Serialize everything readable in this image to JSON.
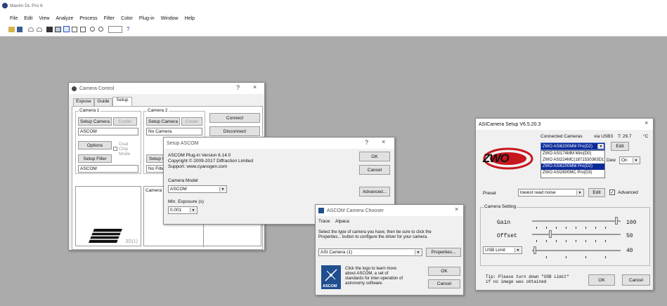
{
  "app": {
    "title": "MaxIm DL Pro 6"
  },
  "menu": [
    "File",
    "Edit",
    "View",
    "Analyze",
    "Process",
    "Filter",
    "Color",
    "Plug-in",
    "Window",
    "Help"
  ],
  "camera_control": {
    "title": "Camera Control",
    "tabs": [
      "Expose",
      "Guide",
      "Setup"
    ],
    "camera1_label": "Camera 1",
    "camera2_label": "Camera 2",
    "setup_camera": "Setup Camera",
    "cooler": "Cooler",
    "camera1_value": "ASCOM",
    "camera2_value": "No Camera",
    "options": "Options",
    "dual_chip_mode": "Dual Chip Mode",
    "setup_filter": "Setup Filter",
    "filter1_value": "ASCOM",
    "filter2_value": "No Filter",
    "connect": "Connect",
    "disconnect": "Disconnect",
    "camera1_status": "Camera 1 i",
    "badge": "3D(1)",
    "help": "?",
    "close": "×"
  },
  "setup_ascom": {
    "title": "Setup ASCOM",
    "line1": "ASCOM Plug-in Version 6.14.0",
    "line2": "Copyright © 2009-2017 Diffraction Limited",
    "line3": "Support: www.cyanogen.com",
    "camera_model_label": "Camera Model",
    "camera_model_value": "ASCOM",
    "min_exposure_label": "Min. Exposure (s)",
    "min_exposure_value": "0.001",
    "ok": "OK",
    "cancel": "Cancel",
    "advanced": "Advanced...",
    "help": "?",
    "close": "×"
  },
  "chooser": {
    "title": "ASCOM Camera Chooser",
    "menu_trace": "Trace",
    "menu_alpaca": "Alpaca",
    "instructions1": "Select the type of camera you have, then be sure to click the",
    "instructions2": "Properties... button to configure the driver for your camera.",
    "selected": "ASI Camera (1)",
    "properties": "Properties...",
    "info1": "Click the logo to learn more",
    "info2": "about ASCOM, a set of",
    "info3": "standards for inter-operation of",
    "info4": "astronomy software.",
    "logo_text": "ASCOM",
    "ok": "OK",
    "cancel": "Cancel",
    "close": "×"
  },
  "asi_setup": {
    "title": "ASICamera Setup V6.5.20.3",
    "close": "×",
    "connected_label": "Connected Cameras",
    "via": "via USB3",
    "temp": "T: 29.7",
    "unit": "°C",
    "selected_camera": "ZWO ASI6200MM Pro(D2)",
    "camera_list": [
      "ZWO ASI174MM Mini(D0)",
      "ZWO ASI224MC(1871530363D1)",
      "ZWO ASI6200MM Pro(D2)",
      "ZWO ASI2600MC Pro(D3)"
    ],
    "edit": "Edit",
    "dew_label": "Dew",
    "dew_value": "On",
    "logo_text": "ZWO",
    "preset_label": "Preset",
    "preset_value": "lowest read noise",
    "preset_edit": "Edit",
    "advanced": "Advanced",
    "camera_setting": "Camera Setting",
    "gain_label": "Gain",
    "gain_value": "100",
    "offset_label": "Offset",
    "offset_value": "50",
    "usb_label": "USB Limit",
    "usb_value": "40",
    "tip_line1": "Tip: Please turn down \"USB Limit\"",
    "tip_line2": "if no image was obtained",
    "ok": "OK",
    "cancel": "Cancel"
  },
  "colors": {
    "desktop": "#ababab",
    "selection": "#0a2a9a",
    "zwo_red": "#c8161d",
    "ascom_blue": "#1f4f8f"
  }
}
